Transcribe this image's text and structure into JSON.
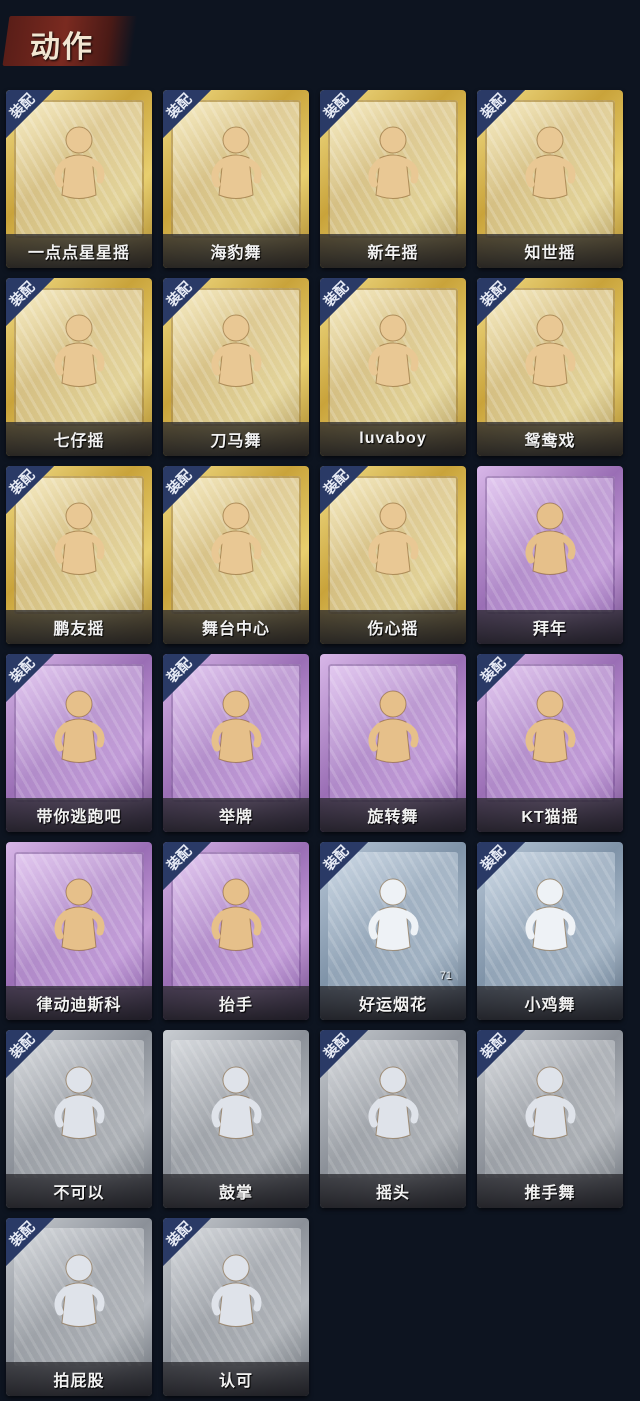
{
  "header": {
    "title": "动作"
  },
  "equip_label": "装配",
  "cards": [
    {
      "label": "一点点星星摇",
      "rarity": "gold",
      "equipped": true
    },
    {
      "label": "海豹舞",
      "rarity": "gold",
      "equipped": true
    },
    {
      "label": "新年摇",
      "rarity": "gold",
      "equipped": true
    },
    {
      "label": "知世摇",
      "rarity": "gold",
      "equipped": true
    },
    {
      "label": "七仔摇",
      "rarity": "gold",
      "equipped": true
    },
    {
      "label": "刀马舞",
      "rarity": "gold",
      "equipped": true
    },
    {
      "label": "luvaboy",
      "rarity": "gold",
      "equipped": true
    },
    {
      "label": "鸳鸯戏",
      "rarity": "gold",
      "equipped": true
    },
    {
      "label": "鹏友摇",
      "rarity": "gold",
      "equipped": true
    },
    {
      "label": "舞台中心",
      "rarity": "gold",
      "equipped": true
    },
    {
      "label": "伤心摇",
      "rarity": "gold",
      "equipped": true
    },
    {
      "label": "拜年",
      "rarity": "purple",
      "equipped": false
    },
    {
      "label": "带你逃跑吧",
      "rarity": "purple",
      "equipped": true
    },
    {
      "label": "举牌",
      "rarity": "purple",
      "equipped": true
    },
    {
      "label": "旋转舞",
      "rarity": "purple",
      "equipped": false
    },
    {
      "label": "KT猫摇",
      "rarity": "purple",
      "equipped": true
    },
    {
      "label": "律动迪斯科",
      "rarity": "purple",
      "equipped": false
    },
    {
      "label": "抬手",
      "rarity": "purple",
      "equipped": true
    },
    {
      "label": "好运烟花",
      "rarity": "blue",
      "equipped": true,
      "count": "71"
    },
    {
      "label": "小鸡舞",
      "rarity": "blue",
      "equipped": true
    },
    {
      "label": "不可以",
      "rarity": "grey",
      "equipped": true
    },
    {
      "label": "鼓掌",
      "rarity": "grey",
      "equipped": false
    },
    {
      "label": "摇头",
      "rarity": "grey",
      "equipped": true
    },
    {
      "label": "推手舞",
      "rarity": "grey",
      "equipped": true
    },
    {
      "label": "拍屁股",
      "rarity": "grey",
      "equipped": true
    },
    {
      "label": "认可",
      "rarity": "grey",
      "equipped": true
    }
  ],
  "colors": {
    "background": "#0d1420",
    "gold": "#c9a33a",
    "purple": "#9a6eb5",
    "blue": "#7f93a8",
    "grey": "#8b9098",
    "badge": "#2a3a66"
  }
}
